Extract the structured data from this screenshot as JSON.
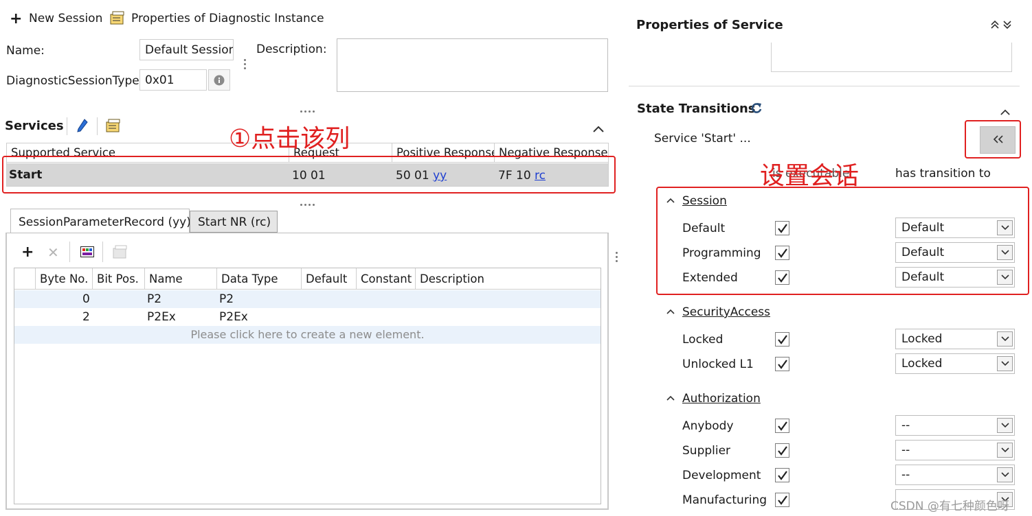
{
  "toolbar": {
    "new_session": "New Session",
    "properties_instance": "Properties of Diagnostic Instance"
  },
  "session_form": {
    "name_label": "Name:",
    "name_value": "Default Session",
    "description_label": "Description:",
    "type_label": "DiagnosticSessionType:",
    "type_value": "0x01"
  },
  "services": {
    "title": "Services",
    "columns": [
      "Supported Service",
      "Request",
      "Positive Response",
      "Negative Response"
    ],
    "row": {
      "service": "Start",
      "request": "10 01",
      "positive_prefix": "50 01",
      "positive_link": "yy",
      "negative_prefix": "7F 10",
      "negative_link": "rc"
    }
  },
  "annotations": {
    "click_column": "①点击该列",
    "set_session": "设置会话"
  },
  "tabs": [
    {
      "label": "SessionParameterRecord (yy)"
    },
    {
      "label": "Start NR (rc)"
    }
  ],
  "param_table": {
    "columns": [
      "Byte No.",
      "Bit Pos.",
      "Name",
      "Data Type",
      "Default",
      "Constant",
      "Description"
    ],
    "rows": [
      {
        "byte": "0",
        "bit": "",
        "name": "P2",
        "type": "P2"
      },
      {
        "byte": "2",
        "bit": "",
        "name": "P2Ex",
        "type": "P2Ex"
      }
    ],
    "placeholder": "Please click here to create a new element."
  },
  "right_panel": {
    "properties_title": "Properties of Service",
    "state_title": "State Transitions",
    "service_label": "Service 'Start' ...",
    "executable_label": "is executable",
    "transition_label": "has transition to",
    "groups": [
      {
        "title": "Session",
        "rows": [
          {
            "label": "Default",
            "checked": true,
            "target": "Default"
          },
          {
            "label": "Programming",
            "checked": true,
            "target": "Default"
          },
          {
            "label": "Extended",
            "checked": true,
            "target": "Default"
          }
        ]
      },
      {
        "title": "SecurityAccess",
        "rows": [
          {
            "label": "Locked",
            "checked": true,
            "target": "Locked"
          },
          {
            "label": "Unlocked L1",
            "checked": true,
            "target": "Locked"
          }
        ]
      },
      {
        "title": "Authorization",
        "rows": [
          {
            "label": "Anybody",
            "checked": true,
            "target": "--"
          },
          {
            "label": "Supplier",
            "checked": true,
            "target": "--"
          },
          {
            "label": "Development",
            "checked": true,
            "target": "--"
          },
          {
            "label": "Manufacturing",
            "checked": true,
            "target": ""
          }
        ]
      }
    ]
  },
  "watermark": "CSDN @有七种颜色呀",
  "colors": {
    "annotation_red": "#e02020",
    "selected_row": "#d6d6d6",
    "link_blue": "#1f3fd0"
  }
}
